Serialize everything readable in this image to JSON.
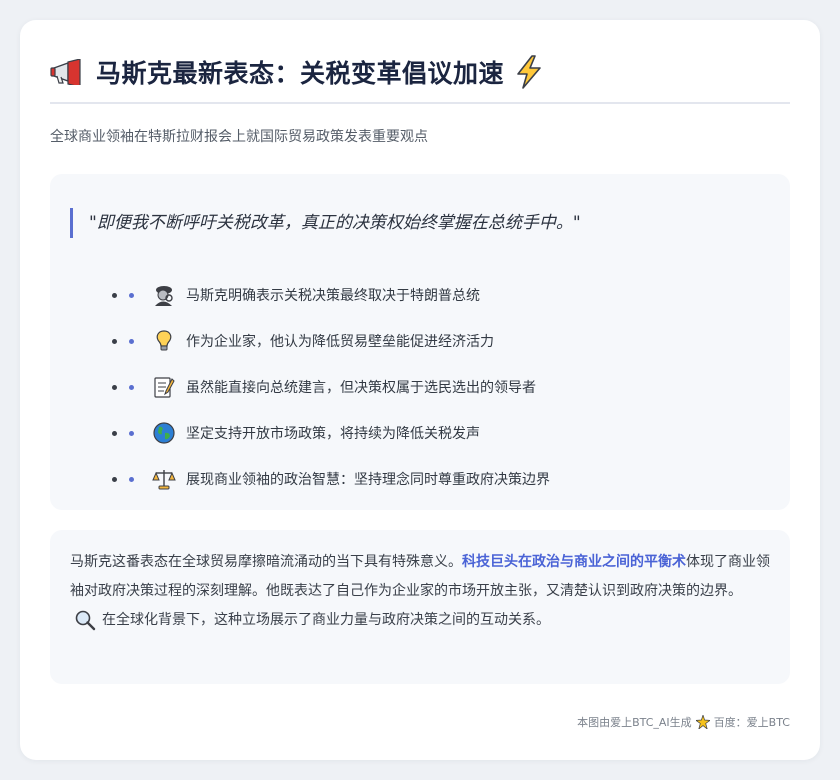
{
  "header": {
    "title": "马斯克最新表态：关税变革倡议加速",
    "left_icon": "megaphone-icon",
    "right_icon": "high-voltage-icon"
  },
  "subtitle": "全球商业领袖在特斯拉财报会上就国际贸易政策发表重要观点",
  "quote_section": {
    "quote": "\"即便我不断呼吁关税改革，真正的决策权始终掌握在总统手中。\"",
    "items": [
      {
        "icon": "detective-icon",
        "text": "马斯克明确表示关税决策最终取决于特朗普总统"
      },
      {
        "icon": "light-bulb-icon",
        "text": "作为企业家，他认为降低贸易壁垒能促进经济活力"
      },
      {
        "icon": "memo-icon",
        "text": "虽然能直接向总统建言，但决策权属于选民选出的领导者"
      },
      {
        "icon": "globe-icon",
        "text": "坚定支持开放市场政策，将持续为降低关税发声"
      },
      {
        "icon": "balance-scale-icon",
        "text": "展现商业领袖的政治智慧：坚持理念同时尊重政府决策边界"
      }
    ]
  },
  "paragraph": {
    "part1": "马斯克这番表态在全球贸易摩擦暗流涌动的当下具有特殊意义。",
    "highlight": "科技巨头在政治与商业之间的平衡术",
    "part2": "体现了商业领袖对政府决策过程的深刻理解。他既表达了自己作为企业家的市场开放主张，又清楚认识到政府决策的边界。",
    "part3": "在全球化背景下，这种立场展示了商业力量与政府决策之间的互动关系。",
    "inline_icon": "magnifying-glass-icon"
  },
  "footer": {
    "left_text": "本图由爱上BTC_AI生成",
    "right_text": "百度：爱上BTC",
    "icon": "sparkle-star-icon"
  },
  "colors": {
    "accent": "#5a6fd0",
    "highlight_text": "#4a63d6",
    "title": "#1b2540",
    "panel_bg": "#f6f8fb",
    "page_bg": "#eef1f5"
  }
}
